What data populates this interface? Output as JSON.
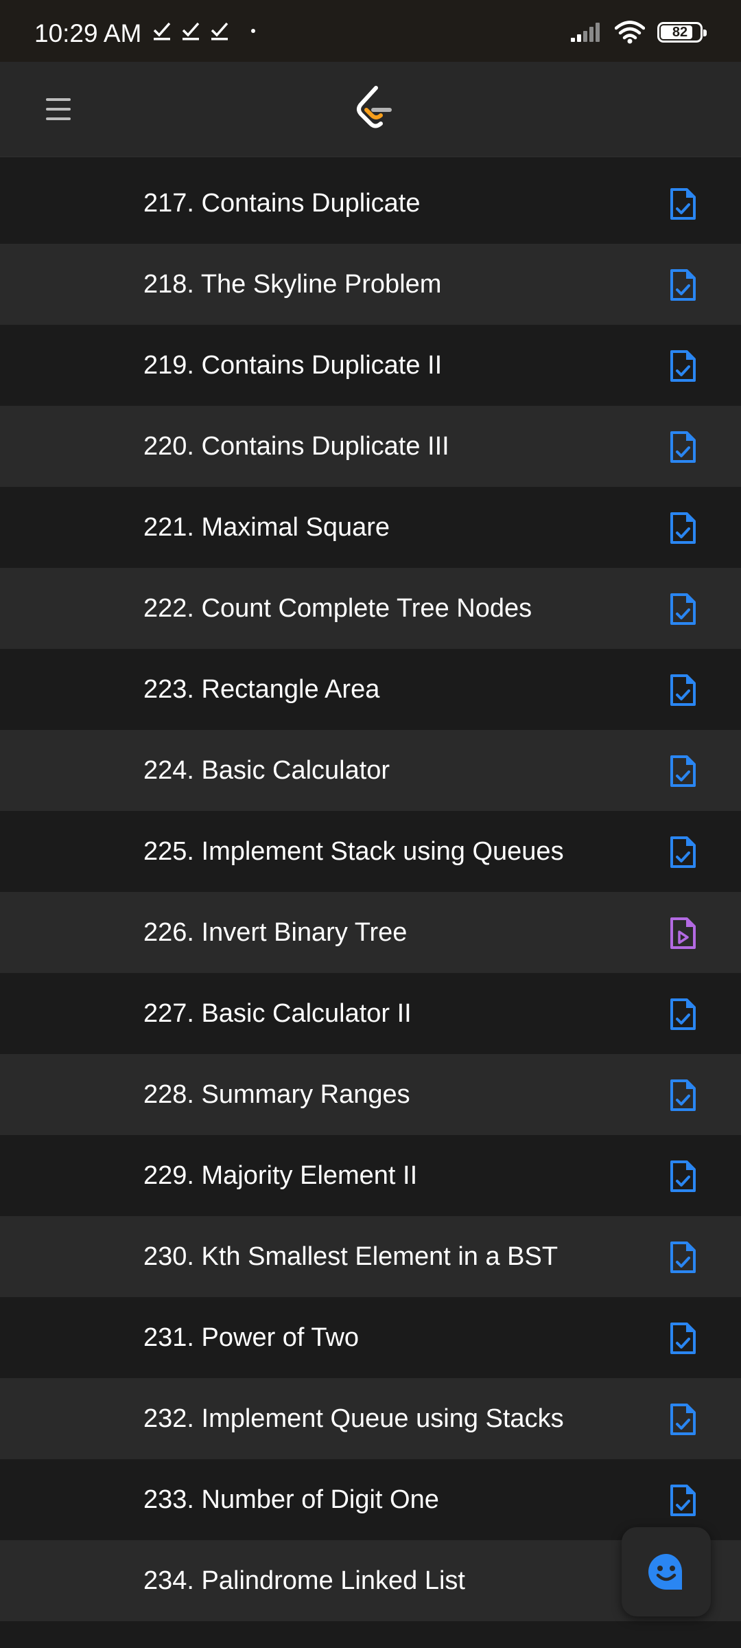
{
  "status_bar": {
    "time": "10:29 AM",
    "battery": "82",
    "battery_level": 0.82
  },
  "header": {
    "menu_icon": "hamburger-menu-icon",
    "logo_icon": "leetcode-logo"
  },
  "colors": {
    "solution_icon": "#2a86f2",
    "video_icon": "#b36ae2",
    "row_dark": "#1b1b1b",
    "row_light": "#2a2a2a",
    "header_bg": "#282828"
  },
  "problems": [
    {
      "title": "217. Contains Duplicate",
      "icon": "solution-doc-check-icon"
    },
    {
      "title": "218. The Skyline Problem",
      "icon": "solution-doc-check-icon"
    },
    {
      "title": "219. Contains Duplicate II",
      "icon": "solution-doc-check-icon"
    },
    {
      "title": "220. Contains Duplicate III",
      "icon": "solution-doc-check-icon"
    },
    {
      "title": "221. Maximal Square",
      "icon": "solution-doc-check-icon"
    },
    {
      "title": "222. Count Complete Tree Nodes",
      "icon": "solution-doc-check-icon"
    },
    {
      "title": "223. Rectangle Area",
      "icon": "solution-doc-check-icon"
    },
    {
      "title": "224. Basic Calculator",
      "icon": "solution-doc-check-icon"
    },
    {
      "title": "225. Implement Stack using Queues",
      "icon": "solution-doc-check-icon"
    },
    {
      "title": "226. Invert Binary Tree",
      "icon": "video-doc-play-icon"
    },
    {
      "title": "227. Basic Calculator II",
      "icon": "solution-doc-check-icon"
    },
    {
      "title": "228. Summary Ranges",
      "icon": "solution-doc-check-icon"
    },
    {
      "title": "229. Majority Element II",
      "icon": "solution-doc-check-icon"
    },
    {
      "title": "230. Kth Smallest Element in a BST",
      "icon": "solution-doc-check-icon"
    },
    {
      "title": "231. Power of Two",
      "icon": "solution-doc-check-icon"
    },
    {
      "title": "232. Implement Queue using Stacks",
      "icon": "solution-doc-check-icon"
    },
    {
      "title": "233. Number of Digit One",
      "icon": "solution-doc-check-icon"
    },
    {
      "title": "234. Palindrome Linked List",
      "icon": ""
    }
  ],
  "chat_button": {
    "icon": "smiley-chat-icon"
  }
}
